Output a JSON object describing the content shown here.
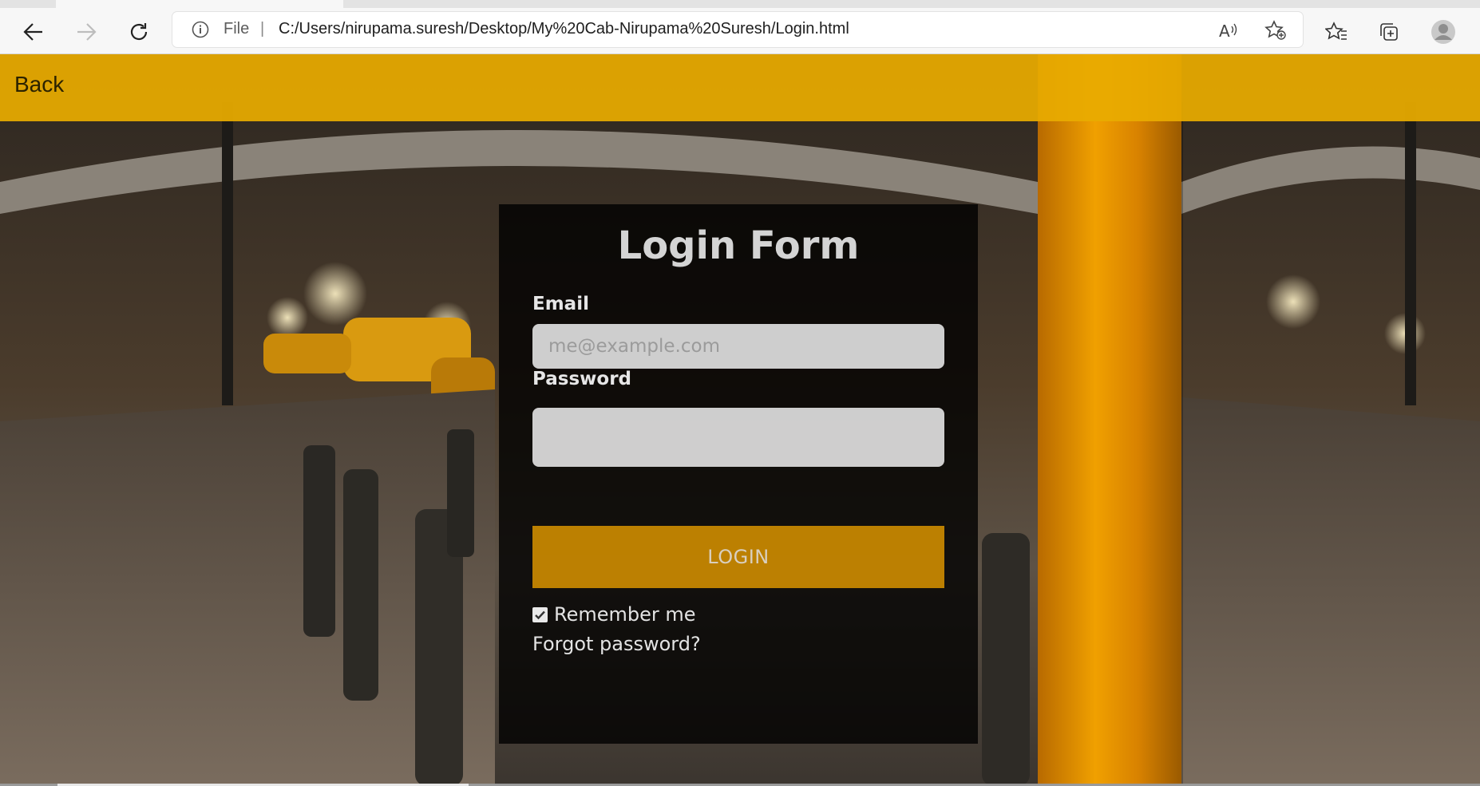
{
  "browser": {
    "file_label": "File",
    "separator": "|",
    "url": "C:/Users/nirupama.suresh/Desktop/My%20Cab-Nirupama%20Suresh/Login.html",
    "icons": [
      "back-arrow-icon",
      "forward-arrow-icon",
      "refresh-icon",
      "info-icon",
      "read-aloud-icon",
      "add-favorite-icon",
      "favorites-icon",
      "collections-icon",
      "profile-avatar-icon"
    ]
  },
  "header": {
    "back_label": "Back",
    "color": "#e8ab00"
  },
  "login_form": {
    "title": "Login Form",
    "email_label": "Email",
    "email_placeholder": "me@example.com",
    "password_label": "Password",
    "password_value": "",
    "login_button": "LOGIN",
    "remember_label": "Remember me",
    "remember_checked": true,
    "forgot_label": "Forgot password?",
    "button_color": "#db9400"
  }
}
